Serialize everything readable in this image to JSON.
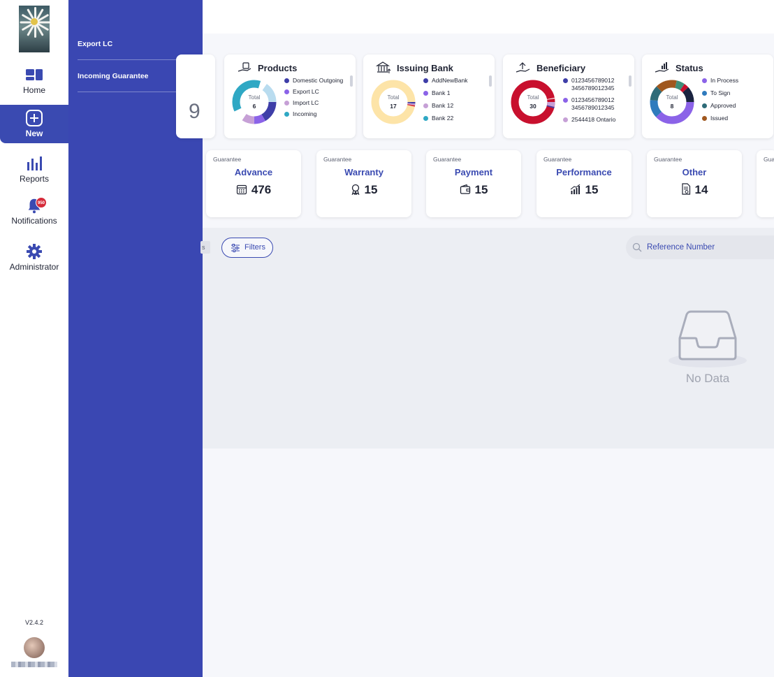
{
  "sidebar": {
    "items": [
      {
        "label": "Home",
        "icon": "dashboard-icon"
      },
      {
        "label": "New",
        "icon": "plus-circle-icon",
        "active": true
      },
      {
        "label": "Reports",
        "icon": "bar-chart-icon"
      },
      {
        "label": "Notifications",
        "icon": "bell-icon",
        "badge": "950"
      },
      {
        "label": "Administrator",
        "icon": "gear-icon"
      }
    ],
    "version": "V2.4.2"
  },
  "flyout": {
    "items": [
      {
        "label": "Export LC"
      },
      {
        "label": "Incoming Guarantee"
      }
    ]
  },
  "partial_value": "9",
  "charts": [
    {
      "title": "Products",
      "total_label": "Total",
      "total": "6",
      "legend": [
        {
          "label": "Domestic Outgoing",
          "color": "#3e3ea8"
        },
        {
          "label": "Export LC",
          "color": "#8b63e8"
        },
        {
          "label": "Import LC",
          "color": "#c6a0d6"
        },
        {
          "label": "Incoming",
          "color": "#2fa8c4"
        }
      ]
    },
    {
      "title": "Issuing Bank",
      "total_label": "Total",
      "total": "17",
      "legend": [
        {
          "label": "AddNewBank",
          "color": "#3e3ea8"
        },
        {
          "label": "Bank 1",
          "color": "#8b63e8"
        },
        {
          "label": "Bank 12",
          "color": "#c6a0d6"
        },
        {
          "label": "Bank 22",
          "color": "#2fa8c4"
        }
      ]
    },
    {
      "title": "Beneficiary",
      "total_label": "Total",
      "total": "30",
      "legend": [
        {
          "label": "0123456789012 3456789012345",
          "color": "#3e3ea8"
        },
        {
          "label": "0123456789012 3456789012345",
          "color": "#8b63e8"
        },
        {
          "label": "2544418 Ontario",
          "color": "#c6a0d6"
        }
      ]
    },
    {
      "title": "Status",
      "total_label": "Total",
      "total": "8",
      "legend": [
        {
          "label": "In Process",
          "color": "#8b63e8"
        },
        {
          "label": "To Sign",
          "color": "#2f7bbd"
        },
        {
          "label": "Approved",
          "color": "#2e6b78"
        },
        {
          "label": "Issued",
          "color": "#a0581f"
        }
      ]
    }
  ],
  "guarantees": [
    {
      "sub": "Guarantee",
      "name": "Advance",
      "count": "476",
      "icon": "calendar-icon"
    },
    {
      "sub": "Guarantee",
      "name": "Warranty",
      "count": "15",
      "icon": "award-icon"
    },
    {
      "sub": "Guarantee",
      "name": "Payment",
      "count": "15",
      "icon": "wallet-icon"
    },
    {
      "sub": "Guarantee",
      "name": "Performance",
      "count": "15",
      "icon": "growth-chart-icon"
    },
    {
      "sub": "Guarantee",
      "name": "Other",
      "count": "14",
      "icon": "document-icon"
    },
    {
      "sub": "Gua",
      "name": "",
      "count": "",
      "icon": ""
    }
  ],
  "toolbar": {
    "chip_text": "s",
    "filters_label": "Filters",
    "search_placeholder": "Reference Number"
  },
  "empty_state": {
    "text": "No Data"
  }
}
